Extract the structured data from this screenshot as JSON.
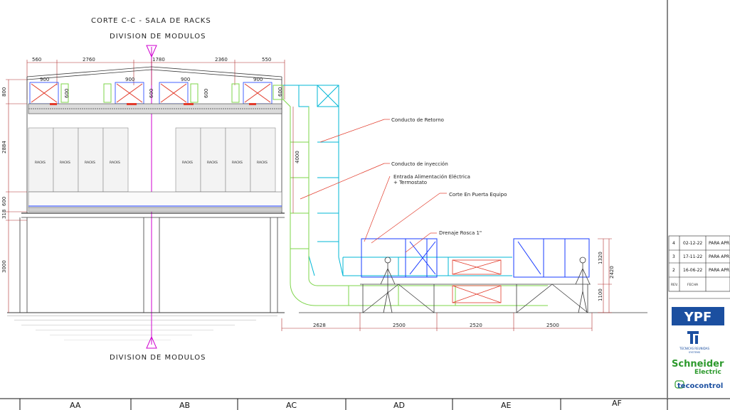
{
  "titles": {
    "section": "CORTE C-C  -  SALA DE RACKS",
    "modules_top": "DIVISION  DE  MODULOS",
    "modules_bottom": "DIVISION  DE  MODULOS"
  },
  "top_dims": [
    "560",
    "2760",
    "1780",
    "2360",
    "550"
  ],
  "unit_dims": [
    "900",
    "900",
    "900",
    "900"
  ],
  "unit_height_dims": [
    "600",
    "600",
    "600",
    "600"
  ],
  "left_dims": {
    "roof": "800",
    "racks": "2884",
    "floor": "600",
    "slab": "318",
    "base": "3000"
  },
  "duct_height": "4000",
  "right_dims": {
    "unit": "1320",
    "total": "2420",
    "base": "1100"
  },
  "bottom_dims": [
    "2628",
    "2500",
    "2520",
    "2500"
  ],
  "rack_labels": [
    "RACKS",
    "RACKS",
    "RACKS",
    "RACKS",
    "RACKS",
    "RACKS",
    "RACKS",
    "RACKS"
  ],
  "callouts": {
    "retorno": "Conducto  de  Retorno",
    "inyeccion": "Conducto  de  inyección",
    "alimentacion_1": "Entrada  Alimentación  Eléctrica",
    "alimentacion_2": "+  Termostato",
    "corte": "Corte  En  Puerta  Equipo",
    "drenaje": "Drenaje  Rosca  1\""
  },
  "revisions": [
    {
      "rev": "4",
      "fecha": "02-12-22",
      "desc": "PARA APR"
    },
    {
      "rev": "3",
      "fecha": "17-11-22",
      "desc": "PARA APR"
    },
    {
      "rev": "2",
      "fecha": "16-06-22",
      "desc": "PARA APR"
    }
  ],
  "rev_header": {
    "rev": "REV.",
    "fecha": "FECHA"
  },
  "logos": {
    "ypf": "YPF",
    "tri": "TECNICAS REUNIDAS",
    "tri_sub": "SYSTEMS",
    "schneider_1": "Schneider",
    "schneider_2": "Electric",
    "ecocontrol": "tecocontrol"
  },
  "grid_columns": [
    "AA",
    "AB",
    "AC",
    "AD",
    "AE",
    "AF"
  ],
  "colors": {
    "building": "#3a3a3a",
    "duct_cyan": "#00b7d6",
    "duct_green": "#7dd44a",
    "red": "#e23b2b",
    "blue": "#1a3cff",
    "axis_magenta": "#d000d0",
    "ypf_blue": "#1b4fa0",
    "schneider_green": "#2d9a2d"
  }
}
